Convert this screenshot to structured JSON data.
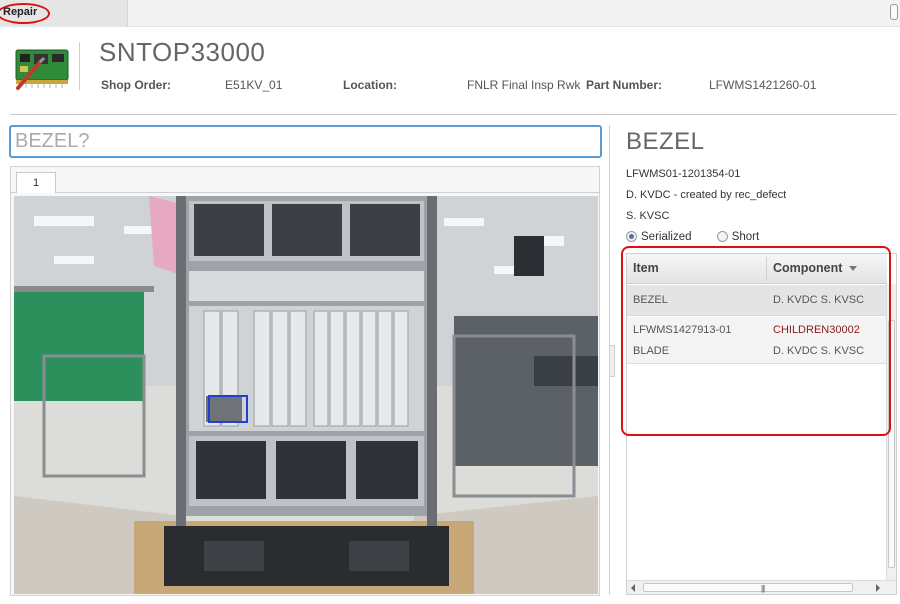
{
  "tabs": {
    "active_label": "Repair"
  },
  "header": {
    "title": "SNTOP33000",
    "shop_order_label": "Shop Order:",
    "shop_order_value": "E51KV_01",
    "location_label": "Location:",
    "location_value": "FNLR Final Insp Rwk",
    "part_number_label": "Part Number:",
    "part_number_value": "LFWMS1421260-01"
  },
  "search": {
    "placeholder": "BEZEL?"
  },
  "image_tabs": [
    "1"
  ],
  "detail": {
    "title": "BEZEL",
    "line1": "LFWMS01-1201354-01",
    "line2": "D. KVDC - created by rec_defect",
    "line3": "S. KVSC",
    "radio_serialized": "Serialized",
    "radio_short": "Short",
    "selected": "Serialized"
  },
  "grid": {
    "columns": [
      "Item",
      "Component"
    ],
    "rows": [
      {
        "item": "BEZEL",
        "component": "D. KVDC S. KVSC"
      },
      {
        "item": "LFWMS1427913-01",
        "component": "CHILDREN30002",
        "item2": "BLADE",
        "component2": "D. KVDC S. KVSC"
      }
    ]
  },
  "colors": {
    "accent": "#5b9bd5",
    "highlight": "#dd1111",
    "component_link": "#8b1a1a"
  }
}
